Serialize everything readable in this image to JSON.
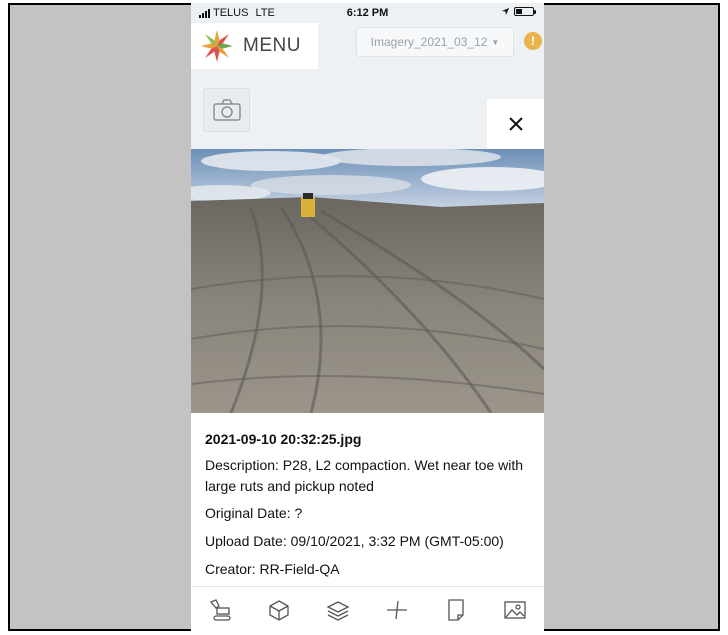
{
  "status_bar": {
    "carrier": "TELUS",
    "network": "LTE",
    "time": "6:12 PM"
  },
  "header": {
    "menu_label": "MENU",
    "layer_select_value": "Imagery_2021_03_12",
    "alert_symbol": "!"
  },
  "actions": {
    "camera_icon": "camera-icon",
    "close_symbol": "×"
  },
  "photo_details": {
    "filename": "2021-09-10 20:32:25.jpg",
    "description": "Description: P28, L2 compaction. Wet near toe with large ruts and pickup noted",
    "original_date": "Original Date: ?",
    "upload_date": "Upload Date: 09/10/2021, 3:32 PM (GMT-05:00)",
    "creator": "Creator: RR-Field-QA"
  },
  "toolbar": {
    "items": [
      "excavator-icon",
      "cube-icon",
      "layers-icon",
      "measure-icon",
      "document-icon",
      "image-icon"
    ]
  },
  "colors": {
    "accent_orange": "#e8b44a",
    "background": "#eef1f4"
  }
}
